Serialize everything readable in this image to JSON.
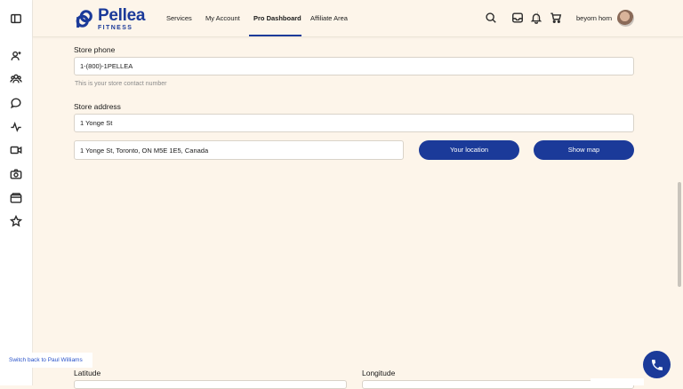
{
  "brand": {
    "name": "Pellea",
    "sub": "FITNESS",
    "color": "#1b3a99"
  },
  "nav": {
    "items": [
      "Services",
      "My Account",
      "Pro Dashboard",
      "Affiliate Area"
    ],
    "active_index": 2
  },
  "header": {
    "username": "beyorn horn"
  },
  "sidebar_icons": [
    "panel-toggle-icon",
    "user-add-icon",
    "users-icon",
    "chat-icon",
    "activity-icon",
    "video-icon",
    "camera-icon",
    "wallet-icon",
    "star-icon"
  ],
  "top_icons": [
    "search-icon",
    "inbox-icon",
    "bell-icon",
    "cart-icon"
  ],
  "form": {
    "phone_label": "Store phone",
    "phone_value": "1-(800)-1PELLEA",
    "phone_hint": "This is your store contact number",
    "address_label": "Store address",
    "address_value": "1 Yonge St",
    "address_full": "1 Yonge St, Toronto, ON M5E 1E5, Canada",
    "your_location_label": "Your location",
    "show_map_label": "Show map",
    "latitude_label": "Latitude",
    "longitude_label": "Longitude"
  },
  "switch_back": "Switch back to Paul Williams"
}
